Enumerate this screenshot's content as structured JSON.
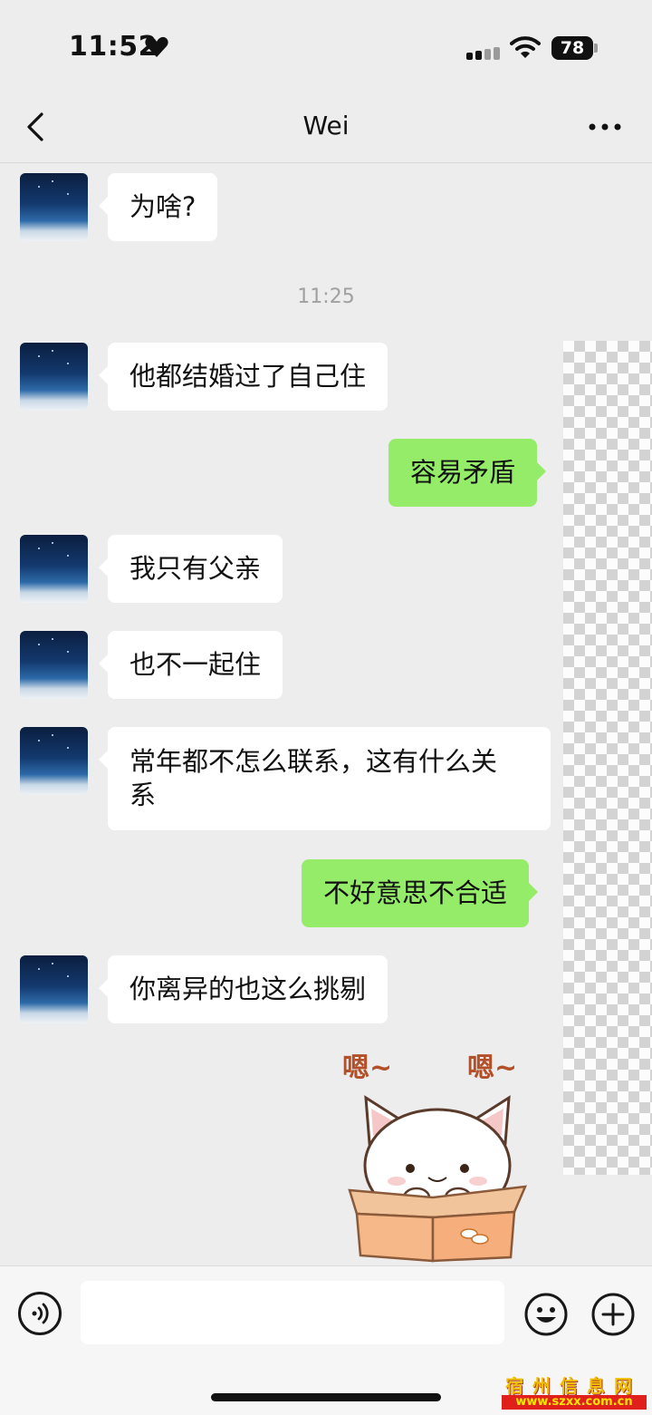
{
  "status": {
    "time": "11:52",
    "battery": "78"
  },
  "nav": {
    "title": "Wei"
  },
  "messages": [
    {
      "side": "in",
      "text": "为啥?"
    },
    {
      "timestamp": "11:25"
    },
    {
      "side": "in",
      "text": "他都结婚过了自己住"
    },
    {
      "side": "out",
      "text": "容易矛盾"
    },
    {
      "side": "in",
      "text": "我只有父亲"
    },
    {
      "side": "in",
      "text": "也不一起住"
    },
    {
      "side": "in",
      "text_line1": "常年都不怎么联系，这有什么关",
      "text_line2": "系"
    },
    {
      "side": "out",
      "text": "不好意思不合适"
    },
    {
      "side": "in",
      "text": "你离异的也这么挑剔"
    },
    {
      "side": "out",
      "type": "sticker",
      "text_left": "嗯~",
      "text_right": "嗯~"
    }
  ],
  "input": {
    "placeholder": ""
  },
  "watermark": {
    "title": "宿州信息网",
    "url": "www.szxx.com.cn"
  }
}
